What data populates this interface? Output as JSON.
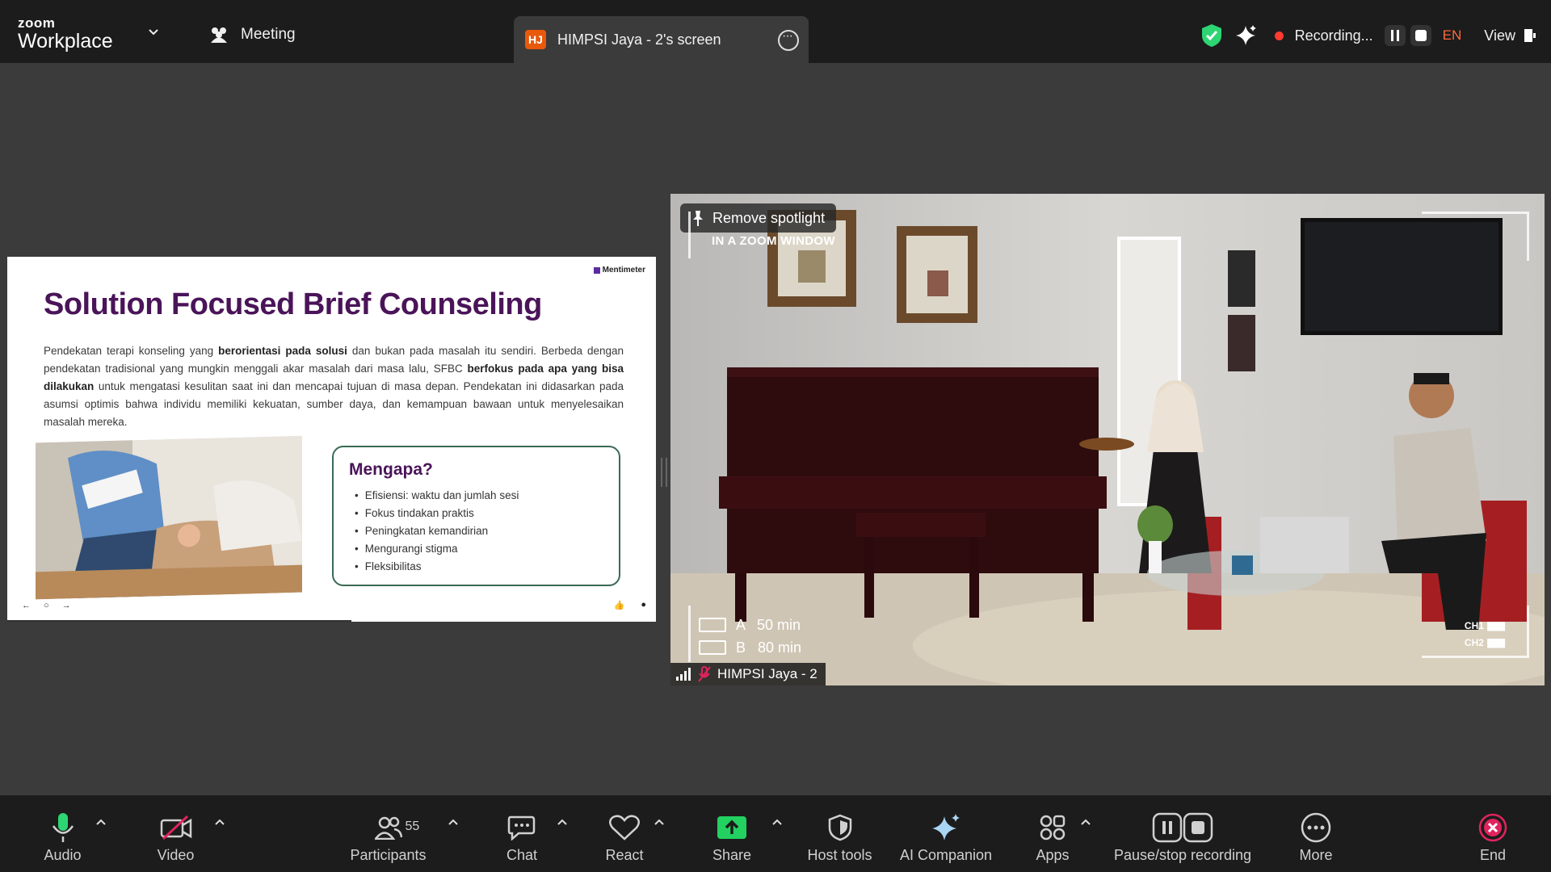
{
  "app": {
    "brand_small": "zoom",
    "brand_big": "Workplace"
  },
  "topbar": {
    "meeting_label": "Meeting",
    "screen_tab": {
      "initials": "HJ",
      "title": "HIMPSI Jaya - 2's screen"
    },
    "recording_label": "Recording...",
    "language": "EN",
    "view_label": "View"
  },
  "slide": {
    "logo": "Mentimeter",
    "title": "Solution Focused Brief Counseling",
    "para_1": "Pendekatan terapi konseling yang ",
    "para_bold_1": "berorientasi pada solusi",
    "para_2": " dan bukan pada masalah itu sendiri. Berbeda dengan pendekatan tradisional yang mungkin menggali akar masalah dari masa lalu, SFBC ",
    "para_bold_2": "berfokus pada apa yang bisa dilakukan",
    "para_3": " untuk mengatasi kesulitan saat ini dan mencapai tujuan di masa depan. Pendekatan ini didasarkan pada asumsi optimis bahwa individu memiliki kekuatan, sumber daya, dan kemampuan bawaan untuk menyelesaikan masalah mereka.",
    "box_title": "Mengapa?",
    "box_items": [
      "Efisiensi: waktu dan jumlah sesi",
      "Fokus tindakan praktis",
      "Peningkatan kemandirian",
      "Mengurangi stigma",
      "Fleksibilitas"
    ],
    "progress": 0.53
  },
  "video": {
    "spotlight_label": "Remove spotlight",
    "window_label": "IN A ZOOM WINDOW",
    "rec_a": "A   50 min",
    "rec_b": "B   80 min",
    "ch1": "CH1",
    "ch2": "CH2",
    "participant_name": "HIMPSI Jaya - 2"
  },
  "toolbar": {
    "audio": "Audio",
    "video": "Video",
    "participants": "Participants",
    "participants_count": "55",
    "chat": "Chat",
    "react": "React",
    "share": "Share",
    "host_tools": "Host tools",
    "ai_companion": "AI Companion",
    "apps": "Apps",
    "pause_stop": "Pause/stop recording",
    "more": "More",
    "end": "End"
  },
  "colors": {
    "accent_green": "#2ed573",
    "share_green": "#23d160",
    "end_red": "#e0245e",
    "title_purple": "#4a1459"
  }
}
